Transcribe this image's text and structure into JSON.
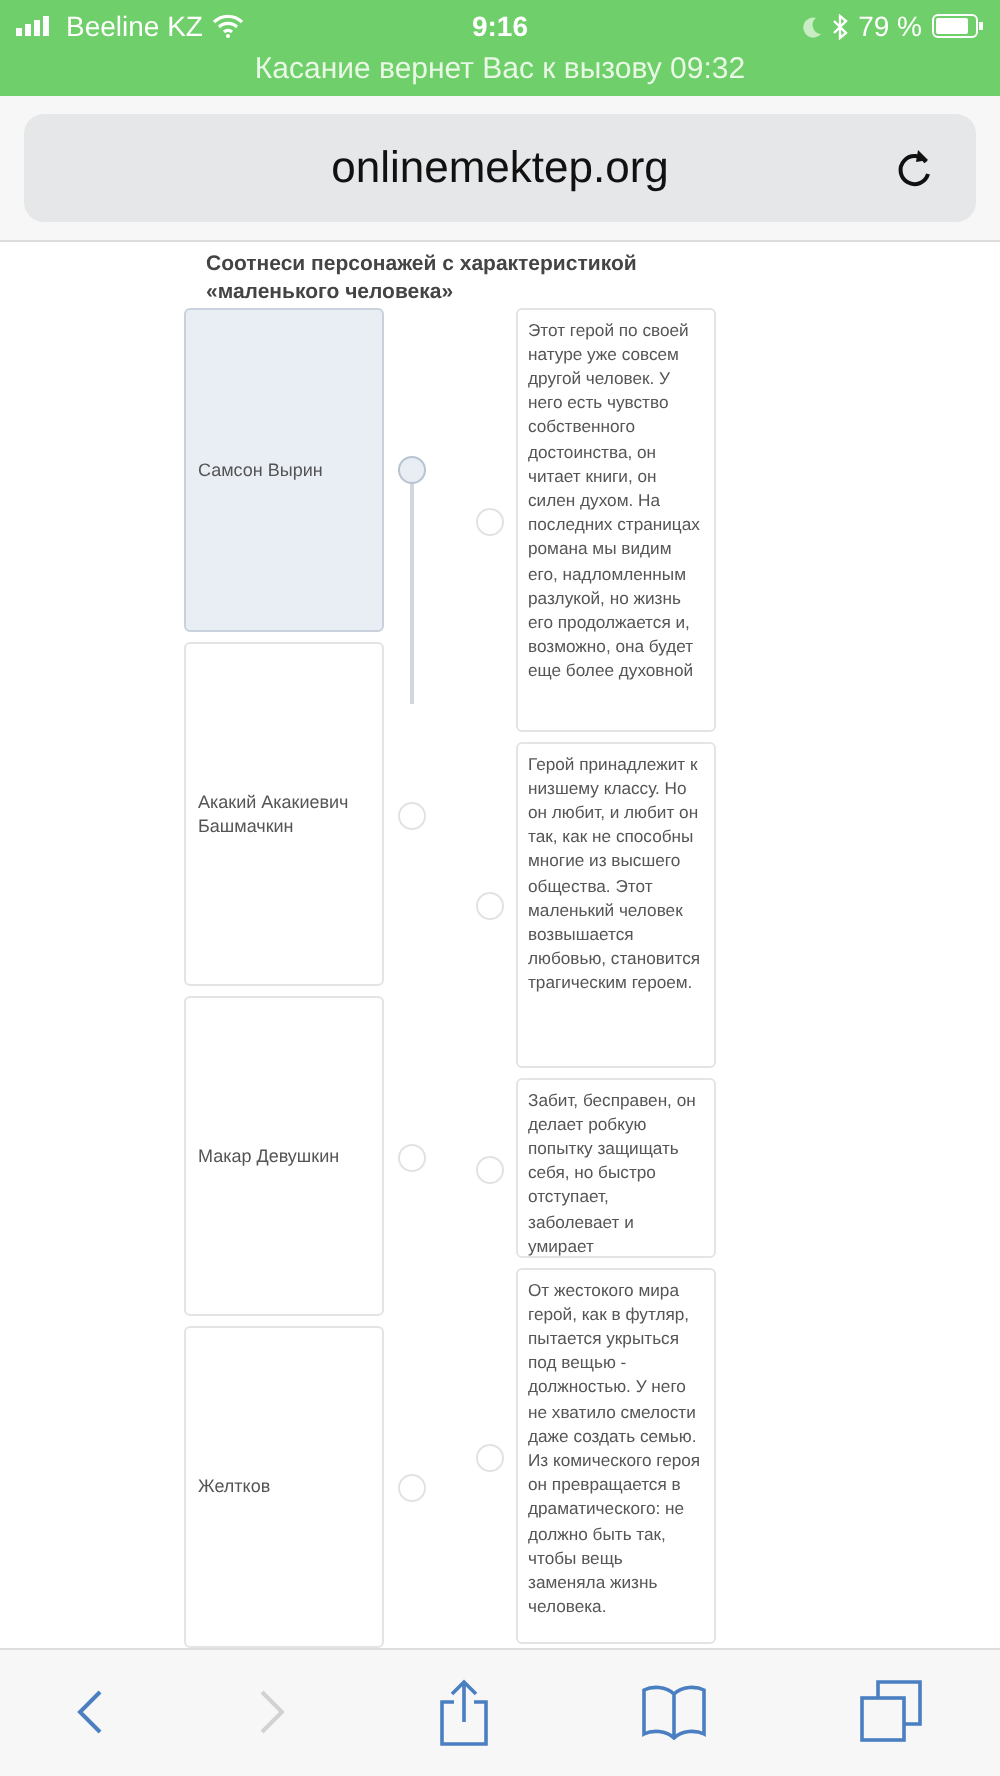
{
  "status_bar": {
    "carrier": "Beeline KZ",
    "time": "9:16",
    "battery": "79 %",
    "call_banner": "Касание вернет Вас к вызову 09:32"
  },
  "address_bar": {
    "url": "onlinemektep.org"
  },
  "question": {
    "title": "Соотнеси персонажей с характеристикой «маленького человека»"
  },
  "left_items": [
    {
      "label": "Самсон Вырин",
      "selected": true
    },
    {
      "label": "Акакий Акакиевич Башмачкин",
      "selected": false
    },
    {
      "label": "Макар Девушкин",
      "selected": false
    },
    {
      "label": "Желтков",
      "selected": false
    }
  ],
  "right_items": [
    {
      "text": "Этот герой по своей натуре уже совсем другой человек. У него есть чувство собственного достоинства, он читает книги, он силен духом. На последних страницах романа мы видим его, надломленным разлукой, но жизнь его продолжается и, возможно, она будет еще более духовной"
    },
    {
      "text": "Герой принадлежит к низшему классу. Но он любит, и любит он так, как не способны многие из высшего общества. Этот маленький человек возвышается любовью, становится трагическим героем."
    },
    {
      "text": "Забит, бесправен, он делает робкую попытку защищать себя, но быстро отступает, заболевает и умирает"
    },
    {
      "text": "От жестокого мира герой, как в футляр, пытается укрыться под вещью - должностью. У него не хватило смелости даже создать семью. Из комического героя он превращается в драматического: не должно быть так, чтобы вещь заменяла жизнь человека."
    }
  ],
  "toolbar": {
    "back_enabled": true,
    "forward_enabled": false
  }
}
